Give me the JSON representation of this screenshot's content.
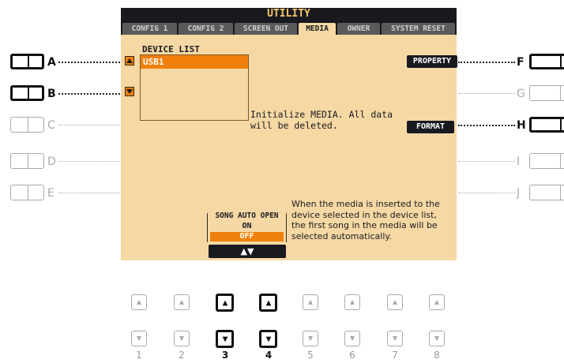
{
  "screen": {
    "title": "UTILITY",
    "tabs": [
      {
        "label": "CONFIG 1",
        "active": false
      },
      {
        "label": "CONFIG 2",
        "active": false
      },
      {
        "label": "SCREEN OUT",
        "active": false
      },
      {
        "label": "MEDIA",
        "active": true
      },
      {
        "label": "OWNER",
        "active": false
      },
      {
        "label": "SYSTEM RESET",
        "active": false
      }
    ],
    "device_list": {
      "title": "DEVICE LIST",
      "items": [
        "USB1"
      ],
      "selected": "USB1"
    },
    "property_button": "PROPERTY",
    "format_button": "FORMAT",
    "format_message": [
      "Initialize MEDIA. All data",
      "will be deleted."
    ],
    "song_auto_open": {
      "label": "SONG AUTO OPEN",
      "options": [
        "ON",
        "OFF"
      ],
      "selected": "OFF"
    },
    "updown_button": "▲▼",
    "auto_open_message": [
      "When the media is inserted to the",
      "device selected in the device list,",
      "the first song in the media will be",
      "selected automatically."
    ]
  },
  "left_buttons": [
    {
      "label": "A",
      "active": true
    },
    {
      "label": "B",
      "active": true
    },
    {
      "label": "C",
      "active": false
    },
    {
      "label": "D",
      "active": false
    },
    {
      "label": "E",
      "active": false
    }
  ],
  "right_buttons": [
    {
      "label": "F",
      "active": true
    },
    {
      "label": "G",
      "active": false
    },
    {
      "label": "H",
      "active": true
    },
    {
      "label": "I",
      "active": false
    },
    {
      "label": "J",
      "active": false
    }
  ],
  "bottom_buttons": [
    {
      "number": "1",
      "active": false
    },
    {
      "number": "2",
      "active": false
    },
    {
      "number": "3",
      "active": true
    },
    {
      "number": "4",
      "active": true
    },
    {
      "number": "5",
      "active": false
    },
    {
      "number": "6",
      "active": false
    },
    {
      "number": "7",
      "active": false
    },
    {
      "number": "8",
      "active": false
    }
  ],
  "colors": {
    "screen_bg": "#f6d8a4",
    "title_bar": "#181a20",
    "title_text": "#f6c66a",
    "accent_orange": "#f0800c",
    "inactive_gray": "#aaaaaa"
  },
  "icons": {
    "screen_up_arrow": "triangle-up-icon",
    "screen_down_arrow": "triangle-down-icon",
    "bottom_up": "triangle-up-icon",
    "bottom_down": "triangle-down-icon"
  }
}
